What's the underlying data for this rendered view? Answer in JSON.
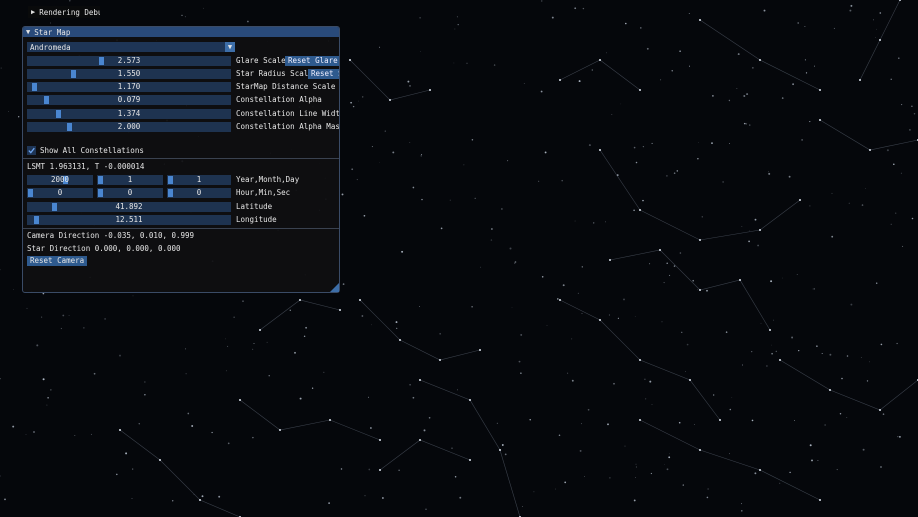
{
  "debug_window": {
    "title": "Rendering Debug"
  },
  "star_map": {
    "title": "Star Map",
    "constellation_combo": {
      "selected": "Andromeda"
    },
    "params": [
      {
        "value": "2.573",
        "fraction": 0.36,
        "label": "Glare Scale",
        "button": "Reset Glare Scale"
      },
      {
        "value": "1.550",
        "fraction": 0.22,
        "label": "Star Radius Scale",
        "button": "Reset Star Radius Scale"
      },
      {
        "value": "1.170",
        "fraction": 0.02,
        "label": "StarMap Distance Scale"
      },
      {
        "value": "0.079",
        "fraction": 0.08,
        "label": "Constellation Alpha"
      },
      {
        "value": "1.374",
        "fraction": 0.14,
        "label": "Constellation Line Width"
      },
      {
        "value": "2.000",
        "fraction": 0.2,
        "label": "Constellation Alpha Mask Power"
      }
    ],
    "show_all_constellations": {
      "label": "Show All Constellations",
      "checked": true
    },
    "lsmt_text": "LSMT 1.963131, T -0.000014",
    "date_row": {
      "values": [
        "2000",
        "1",
        "1"
      ],
      "fractions": [
        0.6,
        0.0,
        0.0
      ],
      "label": "Year,Month,Day"
    },
    "time_row": {
      "values": [
        "0",
        "0",
        "0"
      ],
      "fractions": [
        0.0,
        0.0,
        0.0
      ],
      "label": "Hour,Min,Sec"
    },
    "latitude": {
      "value": "41.892",
      "fraction": 0.12,
      "label": "Latitude"
    },
    "longitude": {
      "value": "12.511",
      "fraction": 0.03,
      "label": "Longitude"
    },
    "camera_direction": "Camera Direction -0.035, 0.010, 0.999",
    "star_direction": "Star Direction 0.000, 0.000, 0.000",
    "reset_camera": "Reset Camera"
  },
  "colors": {
    "background": "#05070b",
    "title_bar": "#294a7a",
    "frame": "#1e3350",
    "grab": "#4a86d0",
    "button": "#2e5a8e"
  }
}
